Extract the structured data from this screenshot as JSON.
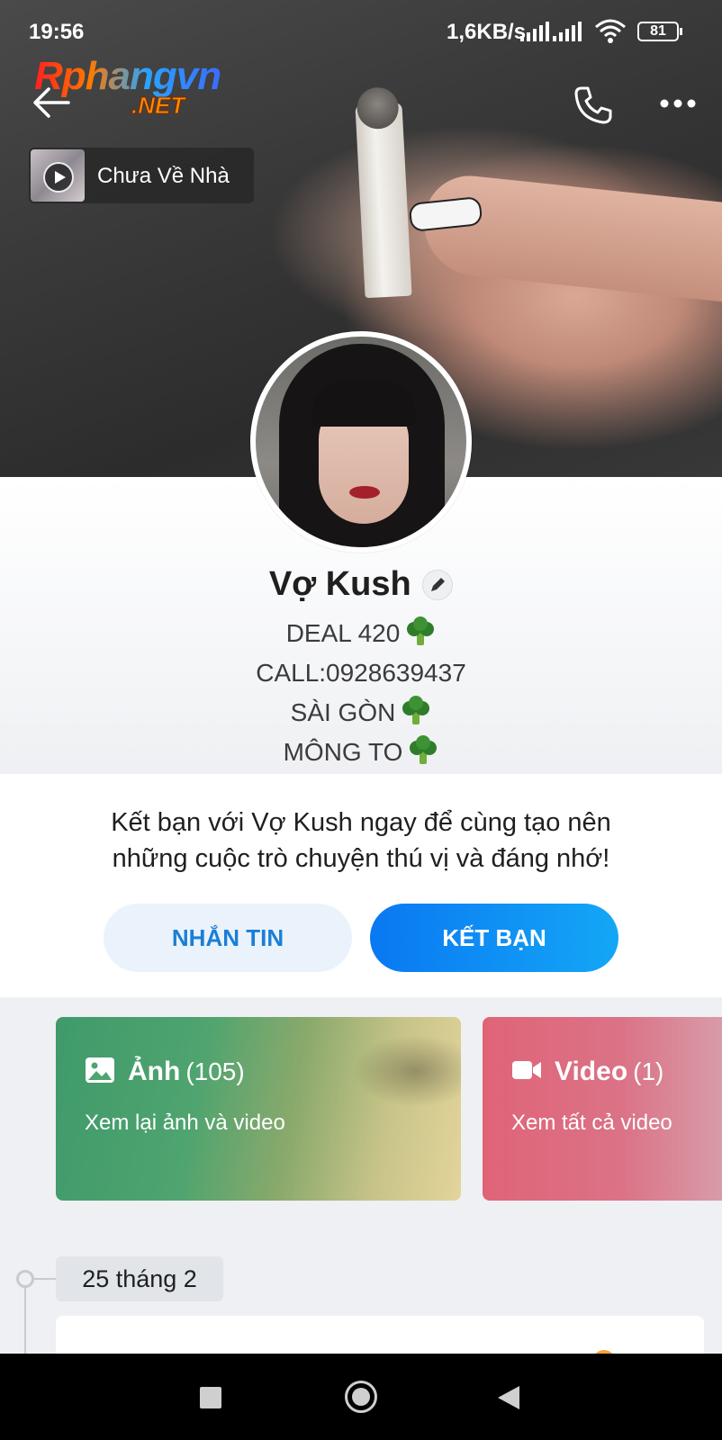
{
  "status_bar": {
    "time": "19:56",
    "network_speed": "1,6KB/s",
    "battery": "81"
  },
  "watermark": {
    "line1": "Rphangvn",
    "line2": ".NET"
  },
  "header": {
    "back_icon": "arrow-left-icon",
    "call_icon": "phone-icon",
    "more_icon": "more-dots-icon"
  },
  "music": {
    "title": "Chưa Về Nhà",
    "play_icon": "play-icon"
  },
  "profile": {
    "name": "Vợ Kush",
    "edit_icon": "pencil-icon",
    "bio": [
      {
        "text": "DEAL 420",
        "emoji": "broccoli-icon"
      },
      {
        "text": "CALL:0928639437",
        "emoji": ""
      },
      {
        "text": "SÀI GÒN",
        "emoji": "broccoli-icon"
      },
      {
        "text": "MÔNG TO",
        "emoji": "broccoli-icon"
      }
    ]
  },
  "friend_prompt": {
    "line1": "Kết bạn với Vợ Kush ngay để cùng tạo nên",
    "line2": "những cuộc trò chuyện thú vị và đáng nhớ!",
    "message_button": "NHẮN TIN",
    "add_friend_button": "KẾT BẠN"
  },
  "media_cards": [
    {
      "title": "Ảnh",
      "count": "(105)",
      "subtitle": "Xem lại ảnh và video",
      "icon": "image-icon",
      "color": "#3f9a6a"
    },
    {
      "title": "Video",
      "count": "(1)",
      "subtitle": "Xem tất cả video",
      "icon": "video-camera-icon",
      "color": "#e06478"
    }
  ],
  "timeline": {
    "date": "25 tháng 2"
  },
  "colors": {
    "accent": "#0a78f2",
    "message_button_bg": "#eaf3fb",
    "message_button_text": "#1a7fd6"
  }
}
